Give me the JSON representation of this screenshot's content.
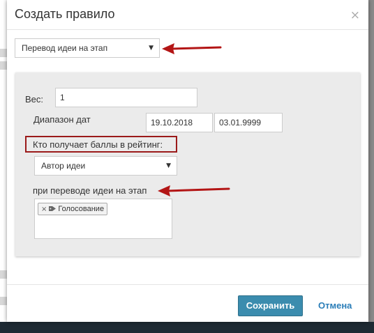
{
  "dialog": {
    "title": "Создать правило",
    "close_glyph": "×"
  },
  "rule_type": {
    "selected": "Перевод идеи на этап",
    "caret": "▼"
  },
  "form": {
    "weight_label": "Вес:",
    "weight_value": "1",
    "date_range_label": "Диапазон дат",
    "date_from": "19.10.2018",
    "date_to": "03.01.9999",
    "rating_recipient_label": "Кто получает баллы в рейтинг:",
    "rating_recipient_selected": "Автор идеи",
    "stage_label": "при переводе идеи на этап",
    "stage_tags": [
      {
        "label": "Голосование",
        "remove_glyph": "×",
        "icon": "tag-icon"
      }
    ]
  },
  "footer": {
    "save_label": "Сохранить",
    "cancel_label": "Отмена"
  },
  "colors": {
    "annotation_red": "#b31515",
    "highlight_border": "#9b1a1a",
    "primary_button": "#3b8cae",
    "link": "#2a7db8"
  }
}
